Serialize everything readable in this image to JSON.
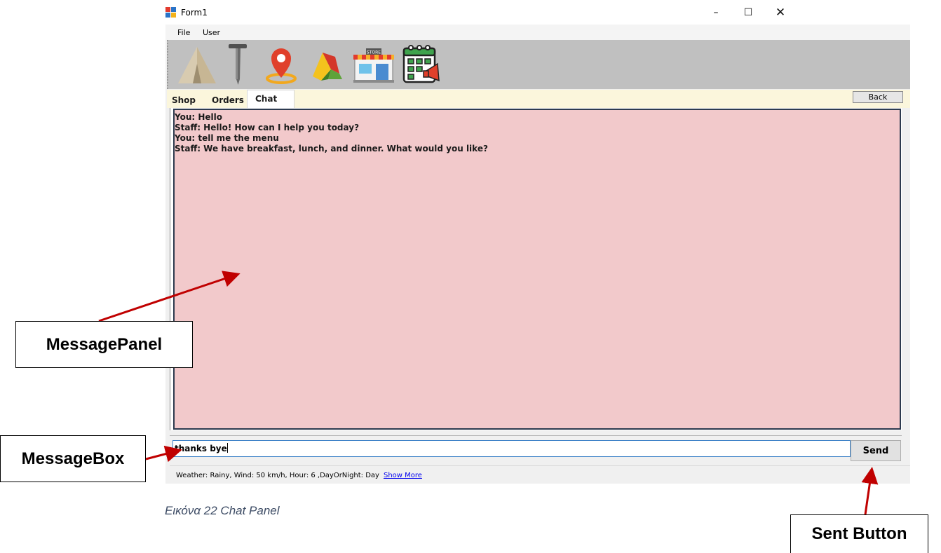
{
  "window": {
    "title": "Form1",
    "controls": {
      "minimize": "–",
      "maximize": "☐",
      "close": "✕"
    }
  },
  "menu": {
    "items": [
      "File",
      "User"
    ]
  },
  "toolbar": {
    "icons": [
      "tent-icon",
      "nail-icon",
      "map-pin-icon",
      "fabric-icon",
      "store-icon",
      "calendar-announcement-icon"
    ],
    "store_sign": "STORE"
  },
  "tabs": {
    "items": [
      "Shop",
      "Orders",
      "Chat"
    ],
    "active": "Chat"
  },
  "back_button": "Back",
  "chat": {
    "messages": [
      "You: Hello",
      "Staff: Hello! How can I help you today?",
      "You: tell me the menu",
      "Staff: We have breakfast, lunch, and dinner. What would you like?"
    ],
    "panel_color": "#f2c9cb"
  },
  "message_box": {
    "value": "thanks bye"
  },
  "send_button": "Send",
  "status": {
    "text": "Weather: Rainy, Wind: 50 km/h, Hour: 6 ,DayOrNight: Day",
    "link": "Show More"
  },
  "annotations": {
    "message_panel": "MessagePanel",
    "message_box": "MessageBox",
    "send_button": "Sent Button",
    "arrow_color": "#c00000"
  },
  "caption": "Εικόνα 22 Chat Panel"
}
